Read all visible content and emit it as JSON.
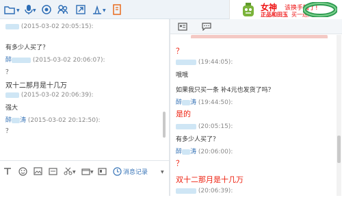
{
  "toolbar_top": {
    "icons": [
      "folder-icon",
      "microphone-icon",
      "video-icon",
      "users-icon",
      "share-icon",
      "screen-capture-icon",
      "book-icon"
    ]
  },
  "ad": {
    "title": "女神",
    "subtitle": "该换手镯了!",
    "line2a": "正品和田玉",
    "line2b": "买一送八"
  },
  "left": {
    "messages": [
      {
        "time": "(2015-03-02 20:05:15):"
      },
      {
        "text": "有多少人买了？"
      },
      {
        "sender": "醉",
        "time": "(2015-03-02 20:06:07):"
      },
      {
        "text": "？"
      },
      {
        "text": "双十二那月是十几万"
      },
      {
        "time": "(2015-03-02 20:06:39):"
      },
      {
        "text": "强大"
      },
      {
        "sender": "醉",
        "sender2": "涛",
        "time": "(2015-03-02 20:12:50):"
      },
      {
        "text": "？"
      }
    ],
    "history_label": "消息记录"
  },
  "right": {
    "messages": [
      {
        "text": "？",
        "red": true
      },
      {
        "time": "(19:44:05):"
      },
      {
        "text": "哦哦"
      },
      {
        "text": "如果我只买一条 补4元也发货了吗？"
      },
      {
        "sender": "醉",
        "sender2": "涛",
        "time": "(19:44:50):"
      },
      {
        "text": "是的",
        "red": true
      },
      {
        "time": "(20:05:15):"
      },
      {
        "text": "有多少人买了？"
      },
      {
        "sender": "醉",
        "sender2": "涛",
        "time": "(20:06:00):"
      },
      {
        "text": "？",
        "red": true
      },
      {
        "text": "双十二那月是十几万",
        "red": true
      },
      {
        "time": "(20:06:39):"
      }
    ]
  }
}
